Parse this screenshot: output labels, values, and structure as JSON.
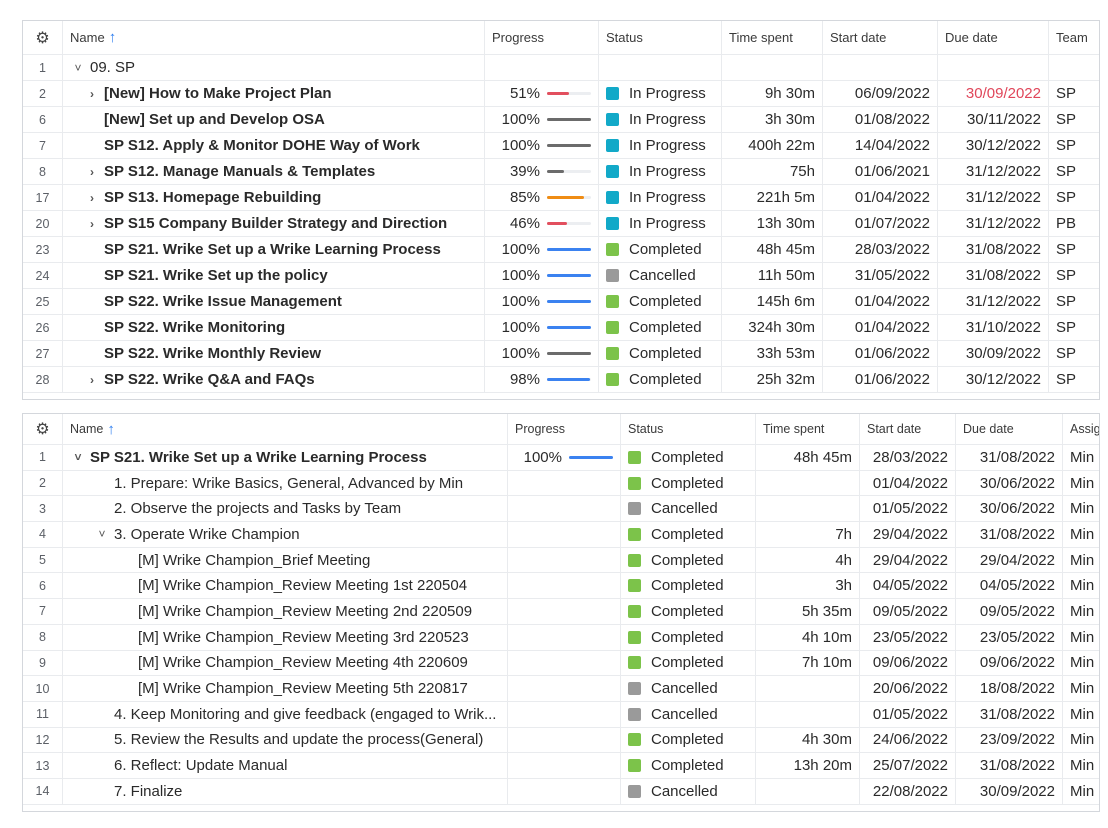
{
  "colors": {
    "in_progress": "#12a9c8",
    "completed": "#7cc34a",
    "cancelled": "#9a9a9a",
    "overdue": "#e0465a",
    "bar_red": "#e24f5e",
    "bar_gray": "#6b6b6b",
    "bar_orange": "#ef8c14",
    "bar_blue": "#3b82f0",
    "sort_arrow": "#2f7ff0"
  },
  "grid1": {
    "settings_icon": "gear-icon",
    "headers": {
      "name": "Name",
      "progress": "Progress",
      "status": "Status",
      "time": "Time spent",
      "start": "Start date",
      "due": "Due date",
      "team": "Team"
    },
    "rows": [
      {
        "num": "1",
        "chevron": "˅",
        "name": "09. SP",
        "bold": false,
        "progress": "",
        "progress_value": null,
        "bar": "",
        "status": "",
        "status_color": "",
        "time": "",
        "start": "",
        "due": "",
        "due_overdue": false,
        "team": ""
      },
      {
        "num": "2",
        "chevron": "›",
        "name": "[New] How to Make Project Plan",
        "bold": true,
        "progress": "51%",
        "progress_value": 0.51,
        "bar": "bar_red",
        "status": "In Progress",
        "status_color": "in_progress",
        "time": "9h 30m",
        "start": "06/09/2022",
        "due": "30/09/2022",
        "due_overdue": true,
        "team": "SP"
      },
      {
        "num": "6",
        "chevron": "",
        "name": "[New] Set up and Develop OSA",
        "bold": true,
        "progress": "100%",
        "progress_value": 1.0,
        "bar": "bar_gray",
        "status": "In Progress",
        "status_color": "in_progress",
        "time": "3h 30m",
        "start": "01/08/2022",
        "due": "30/11/2022",
        "due_overdue": false,
        "team": "SP"
      },
      {
        "num": "7",
        "chevron": "",
        "name": "SP S12. Apply & Monitor DOHE Way of Work",
        "bold": true,
        "progress": "100%",
        "progress_value": 1.0,
        "bar": "bar_gray",
        "status": "In Progress",
        "status_color": "in_progress",
        "time": "400h 22m",
        "start": "14/04/2022",
        "due": "30/12/2022",
        "due_overdue": false,
        "team": "SP"
      },
      {
        "num": "8",
        "chevron": "›",
        "name": "SP S12. Manage Manuals & Templates",
        "bold": true,
        "progress": "39%",
        "progress_value": 0.39,
        "bar": "bar_gray",
        "status": "In Progress",
        "status_color": "in_progress",
        "time": "75h",
        "start": "01/06/2021",
        "due": "31/12/2022",
        "due_overdue": false,
        "team": "SP"
      },
      {
        "num": "17",
        "chevron": "›",
        "name": "SP S13. Homepage Rebuilding",
        "bold": true,
        "progress": "85%",
        "progress_value": 0.85,
        "bar": "bar_orange",
        "status": "In Progress",
        "status_color": "in_progress",
        "time": "221h 5m",
        "start": "01/04/2022",
        "due": "31/12/2022",
        "due_overdue": false,
        "team": "SP"
      },
      {
        "num": "20",
        "chevron": "›",
        "name": "SP S15 Company Builder Strategy and Direction",
        "bold": true,
        "progress": "46%",
        "progress_value": 0.46,
        "bar": "bar_red",
        "status": "In Progress",
        "status_color": "in_progress",
        "time": "13h 30m",
        "start": "01/07/2022",
        "due": "31/12/2022",
        "due_overdue": false,
        "team": "PB"
      },
      {
        "num": "23",
        "chevron": "",
        "name": "SP S21. Wrike Set up a Wrike Learning Process",
        "bold": true,
        "progress": "100%",
        "progress_value": 1.0,
        "bar": "bar_blue",
        "status": "Completed",
        "status_color": "completed",
        "time": "48h 45m",
        "start": "28/03/2022",
        "due": "31/08/2022",
        "due_overdue": false,
        "team": "SP"
      },
      {
        "num": "24",
        "chevron": "",
        "name": "SP S21. Wrike Set up the policy",
        "bold": true,
        "progress": "100%",
        "progress_value": 1.0,
        "bar": "bar_blue",
        "status": "Cancelled",
        "status_color": "cancelled",
        "time": "11h 50m",
        "start": "31/05/2022",
        "due": "31/08/2022",
        "due_overdue": false,
        "team": "SP"
      },
      {
        "num": "25",
        "chevron": "",
        "name": "SP S22. Wrike Issue Management",
        "bold": true,
        "progress": "100%",
        "progress_value": 1.0,
        "bar": "bar_blue",
        "status": "Completed",
        "status_color": "completed",
        "time": "145h 6m",
        "start": "01/04/2022",
        "due": "31/12/2022",
        "due_overdue": false,
        "team": "SP"
      },
      {
        "num": "26",
        "chevron": "",
        "name": "SP S22. Wrike Monitoring",
        "bold": true,
        "progress": "100%",
        "progress_value": 1.0,
        "bar": "bar_blue",
        "status": "Completed",
        "status_color": "completed",
        "time": "324h 30m",
        "start": "01/04/2022",
        "due": "31/10/2022",
        "due_overdue": false,
        "team": "SP"
      },
      {
        "num": "27",
        "chevron": "",
        "name": "SP S22. Wrike Monthly Review",
        "bold": true,
        "progress": "100%",
        "progress_value": 1.0,
        "bar": "bar_gray",
        "status": "Completed",
        "status_color": "completed",
        "time": "33h 53m",
        "start": "01/06/2022",
        "due": "30/09/2022",
        "due_overdue": false,
        "team": "SP"
      },
      {
        "num": "28",
        "chevron": "›",
        "name": "SP S22. Wrike Q&A and FAQs",
        "bold": true,
        "progress": "98%",
        "progress_value": 0.98,
        "bar": "bar_blue",
        "status": "Completed",
        "status_color": "completed",
        "time": "25h 32m",
        "start": "01/06/2022",
        "due": "30/12/2022",
        "due_overdue": false,
        "team": "SP"
      }
    ]
  },
  "grid2": {
    "settings_icon": "gear-icon",
    "headers": {
      "name": "Name",
      "progress": "Progress",
      "status": "Status",
      "time": "Time spent",
      "start": "Start date",
      "due": "Due date",
      "assignee": "Assig"
    },
    "rows": [
      {
        "num": "1",
        "indent": 0,
        "chevron": "˅",
        "name": "SP S21. Wrike Set up a Wrike Learning Process",
        "bold": true,
        "progress": "100%",
        "progress_value": 1.0,
        "bar": "bar_blue",
        "status": "Completed",
        "status_color": "completed",
        "time": "48h 45m",
        "start": "28/03/2022",
        "due": "31/08/2022",
        "assignee": "Min"
      },
      {
        "num": "2",
        "indent": 1,
        "chevron": "",
        "name": "1. Prepare: Wrike Basics, General, Advanced by Min",
        "bold": false,
        "progress": "",
        "progress_value": null,
        "bar": "",
        "status": "Completed",
        "status_color": "completed",
        "time": "",
        "start": "01/04/2022",
        "due": "30/06/2022",
        "assignee": "Min"
      },
      {
        "num": "3",
        "indent": 1,
        "chevron": "",
        "name": "2. Observe the projects and Tasks by Team",
        "bold": false,
        "progress": "",
        "progress_value": null,
        "bar": "",
        "status": "Cancelled",
        "status_color": "cancelled",
        "time": "",
        "start": "01/05/2022",
        "due": "30/06/2022",
        "assignee": "Min"
      },
      {
        "num": "4",
        "indent": 1,
        "chevron": "˅",
        "name": "3. Operate Wrike Champion",
        "bold": false,
        "progress": "",
        "progress_value": null,
        "bar": "",
        "status": "Completed",
        "status_color": "completed",
        "time": "7h",
        "start": "29/04/2022",
        "due": "31/08/2022",
        "assignee": "Min"
      },
      {
        "num": "5",
        "indent": 2,
        "chevron": "",
        "name": "[M] Wrike Champion_Brief Meeting",
        "bold": false,
        "progress": "",
        "progress_value": null,
        "bar": "",
        "status": "Completed",
        "status_color": "completed",
        "time": "4h",
        "start": "29/04/2022",
        "due": "29/04/2022",
        "assignee": "Min"
      },
      {
        "num": "6",
        "indent": 2,
        "chevron": "",
        "name": "[M] Wrike Champion_Review Meeting 1st 220504",
        "bold": false,
        "progress": "",
        "progress_value": null,
        "bar": "",
        "status": "Completed",
        "status_color": "completed",
        "time": "3h",
        "start": "04/05/2022",
        "due": "04/05/2022",
        "assignee": "Min"
      },
      {
        "num": "7",
        "indent": 2,
        "chevron": "",
        "name": "[M] Wrike Champion_Review Meeting 2nd 220509",
        "bold": false,
        "progress": "",
        "progress_value": null,
        "bar": "",
        "status": "Completed",
        "status_color": "completed",
        "time": "5h 35m",
        "start": "09/05/2022",
        "due": "09/05/2022",
        "assignee": "Min"
      },
      {
        "num": "8",
        "indent": 2,
        "chevron": "",
        "name": "[M] Wrike Champion_Review Meeting 3rd 220523",
        "bold": false,
        "progress": "",
        "progress_value": null,
        "bar": "",
        "status": "Completed",
        "status_color": "completed",
        "time": "4h 10m",
        "start": "23/05/2022",
        "due": "23/05/2022",
        "assignee": "Min"
      },
      {
        "num": "9",
        "indent": 2,
        "chevron": "",
        "name": "[M] Wrike Champion_Review Meeting 4th 220609",
        "bold": false,
        "progress": "",
        "progress_value": null,
        "bar": "",
        "status": "Completed",
        "status_color": "completed",
        "time": "7h 10m",
        "start": "09/06/2022",
        "due": "09/06/2022",
        "assignee": "Min"
      },
      {
        "num": "10",
        "indent": 2,
        "chevron": "",
        "name": "[M] Wrike Champion_Review Meeting 5th 220817",
        "bold": false,
        "progress": "",
        "progress_value": null,
        "bar": "",
        "status": "Cancelled",
        "status_color": "cancelled",
        "time": "",
        "start": "20/06/2022",
        "due": "18/08/2022",
        "assignee": "Min"
      },
      {
        "num": "11",
        "indent": 1,
        "chevron": "",
        "name": "4. Keep Monitoring and give feedback (engaged to Wrik...",
        "bold": false,
        "progress": "",
        "progress_value": null,
        "bar": "",
        "status": "Cancelled",
        "status_color": "cancelled",
        "time": "",
        "start": "01/05/2022",
        "due": "31/08/2022",
        "assignee": "Min"
      },
      {
        "num": "12",
        "indent": 1,
        "chevron": "",
        "name": "5. Review the Results and update the process(General)",
        "bold": false,
        "progress": "",
        "progress_value": null,
        "bar": "",
        "status": "Completed",
        "status_color": "completed",
        "time": "4h 30m",
        "start": "24/06/2022",
        "due": "23/09/2022",
        "assignee": "Min"
      },
      {
        "num": "13",
        "indent": 1,
        "chevron": "",
        "name": "6. Reflect: Update Manual",
        "bold": false,
        "progress": "",
        "progress_value": null,
        "bar": "",
        "status": "Completed",
        "status_color": "completed",
        "time": "13h 20m",
        "start": "25/07/2022",
        "due": "31/08/2022",
        "assignee": "Min"
      },
      {
        "num": "14",
        "indent": 1,
        "chevron": "",
        "name": "7. Finalize",
        "bold": false,
        "progress": "",
        "progress_value": null,
        "bar": "",
        "status": "Cancelled",
        "status_color": "cancelled",
        "time": "",
        "start": "22/08/2022",
        "due": "30/09/2022",
        "assignee": "Min"
      }
    ]
  }
}
